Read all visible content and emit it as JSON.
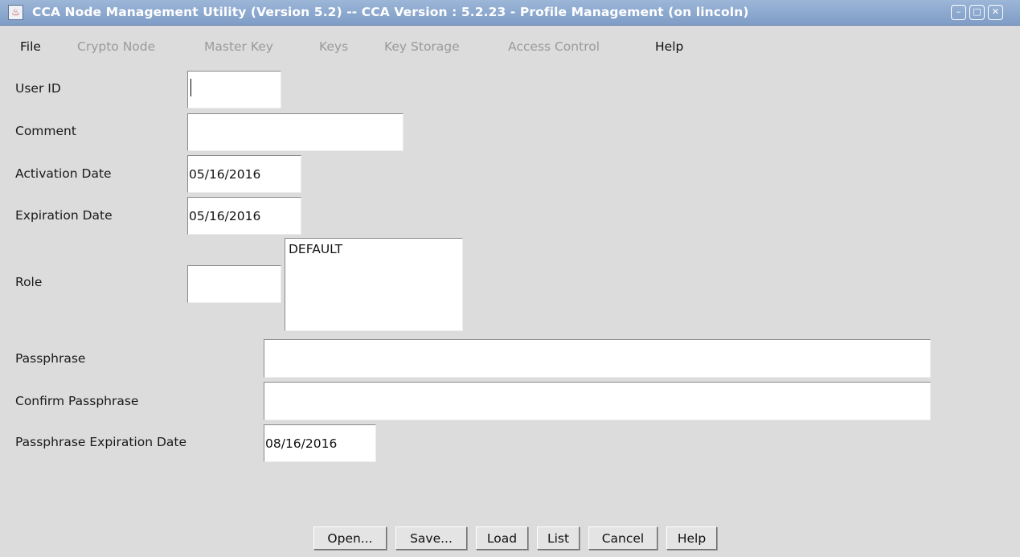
{
  "window": {
    "title": "CCA Node Management Utility (Version 5.2) -- CCA Version : 5.2.23  - Profile Management (on lincoln)",
    "title_bar_color": "#8aa6cf",
    "controls": {
      "minimize": "–",
      "maximize": "□",
      "close": "✕"
    }
  },
  "menu": {
    "file": "File",
    "crypto_node": "Crypto Node",
    "master_key": "Master Key",
    "keys": "Keys",
    "key_storage": "Key Storage",
    "access_control": "Access Control",
    "help": "Help"
  },
  "form": {
    "user_id": {
      "label": "User ID",
      "value": ""
    },
    "comment": {
      "label": "Comment",
      "value": ""
    },
    "activation_date": {
      "label": "Activation Date",
      "value": "05/16/2016"
    },
    "expiration_date": {
      "label": "Expiration Date",
      "value": "05/16/2016"
    },
    "role": {
      "label": "Role",
      "value": "",
      "options": [
        "DEFAULT"
      ]
    },
    "passphrase": {
      "label": "Passphrase",
      "value": ""
    },
    "confirm_passphrase": {
      "label": "Confirm Passphrase",
      "value": ""
    },
    "passphrase_expiration_date": {
      "label": "Passphrase Expiration Date",
      "value": "08/16/2016"
    }
  },
  "buttons": {
    "open": "Open...",
    "save": "Save...",
    "load": "Load",
    "list": "List",
    "cancel": "Cancel",
    "help": "Help"
  }
}
